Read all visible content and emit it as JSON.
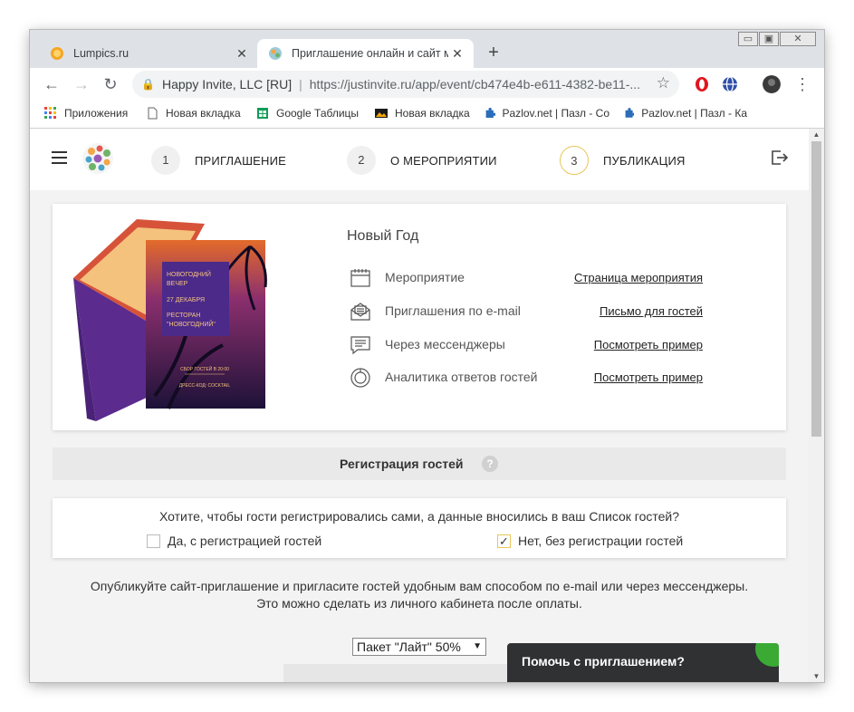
{
  "browser": {
    "tabs": [
      {
        "title": "Lumpics.ru",
        "active": false
      },
      {
        "title": "Приглашение онлайн и сайт ме",
        "active": true
      }
    ],
    "new_tab": "+",
    "window_controls": {
      "minimize": "▭",
      "maximize": "▣",
      "close": "✕"
    },
    "address": {
      "site_name": "Happy Invite, LLC [RU]",
      "url": "https://justinvite.ru/app/event/cb474e4b-e611-4382-be11-..."
    },
    "bookmarks": [
      "Приложения",
      "Новая вкладка",
      "Google Таблицы",
      "Новая вкладка",
      "Pazlov.net | Пазл - Со",
      "Pazlov.net | Пазл - Ка"
    ]
  },
  "app": {
    "steps": [
      {
        "number": "1",
        "label": "ПРИГЛАШЕНИЕ"
      },
      {
        "number": "2",
        "label": "О МЕРОПРИЯТИИ"
      },
      {
        "number": "3",
        "label": "ПУБЛИКАЦИЯ"
      }
    ],
    "event": {
      "title": "Новый Год",
      "card_text": [
        "НОВОГОДНИЙ",
        "ВЕЧЕР",
        "27 ДЕКАБРЯ",
        "РЕСТОРАН",
        "\"НОВОГОДНИЙ\"",
        "СБОР ГОСТЕЙ В 20:00",
        "ДРЕСС-КОД: COCKTAIL"
      ],
      "rows": [
        {
          "icon": "calendar-icon",
          "label": "Мероприятие",
          "link": "Страница мероприятия"
        },
        {
          "icon": "envelope-icon",
          "label": "Приглашения по e-mail",
          "link": "Письмо для гостей"
        },
        {
          "icon": "chat-icon",
          "label": "Через мессенджеры",
          "link": "Посмотреть пример"
        },
        {
          "icon": "target-icon",
          "label": "Аналитика ответов гостей",
          "link": "Посмотреть пример"
        }
      ]
    },
    "registration": {
      "header": "Регистрация гостей",
      "help": "?",
      "question": "Хотите, чтобы гости регистрировались сами, а данные вносились в ваш Список гостей?",
      "option_yes": "Да, с регистрацией гостей",
      "option_no": "Нет, без регистрации гостей",
      "selected": "no"
    },
    "publish": {
      "line1": "Опубликуйте сайт-приглашение и пригласите гостей удобным вам способом по e-mail или через мессенджеры.",
      "line2": "Это можно сделать из личного кабинета после оплаты."
    },
    "package_select": "Пакет \"Лайт\" 50%",
    "help_chat": "Помочь с приглашением?"
  }
}
